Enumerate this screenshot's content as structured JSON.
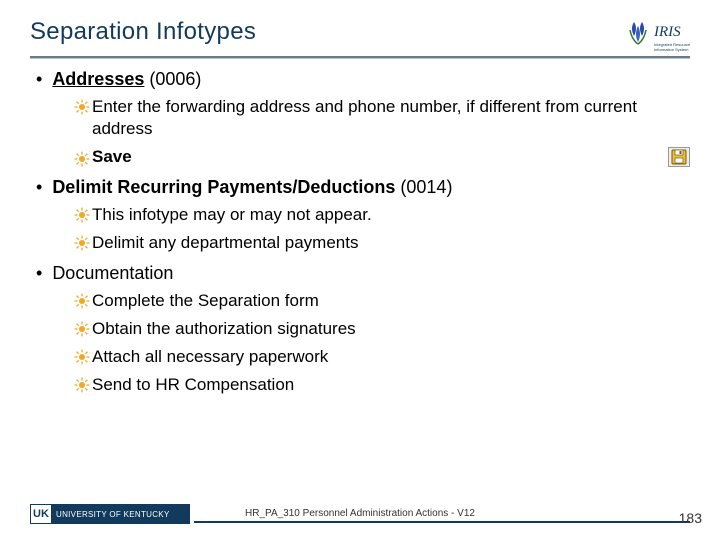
{
  "title": "Separation Infotypes",
  "logo_label": "IRIS",
  "sections": [
    {
      "heading_bold": "Addresses",
      "heading_rest": " (0006)",
      "heading_underline": true,
      "items": [
        {
          "text": "Enter the forwarding address and phone number, if different from current address"
        },
        {
          "text": "Save",
          "bold": true,
          "save_icon": true
        }
      ]
    },
    {
      "heading_bold": "Delimit Recurring Payments/Deductions",
      "heading_rest": " (0014)",
      "heading_underline": false,
      "items": [
        {
          "text": "This infotype may or may not appear."
        },
        {
          "text": "Delimit any departmental payments"
        }
      ]
    },
    {
      "heading_bold": "",
      "heading_rest": "Documentation",
      "heading_underline": false,
      "items": [
        {
          "text": "Complete the Separation form"
        },
        {
          "text": "Obtain the authorization signatures"
        },
        {
          "text": "Attach all necessary paperwork"
        },
        {
          "text": "Send to HR Compensation"
        }
      ]
    }
  ],
  "footer": {
    "org_short": "UK",
    "org_name": "UNIVERSITY OF KENTUCKY",
    "caption": "HR_PA_310 Personnel Administration Actions - V12",
    "page": "183"
  }
}
